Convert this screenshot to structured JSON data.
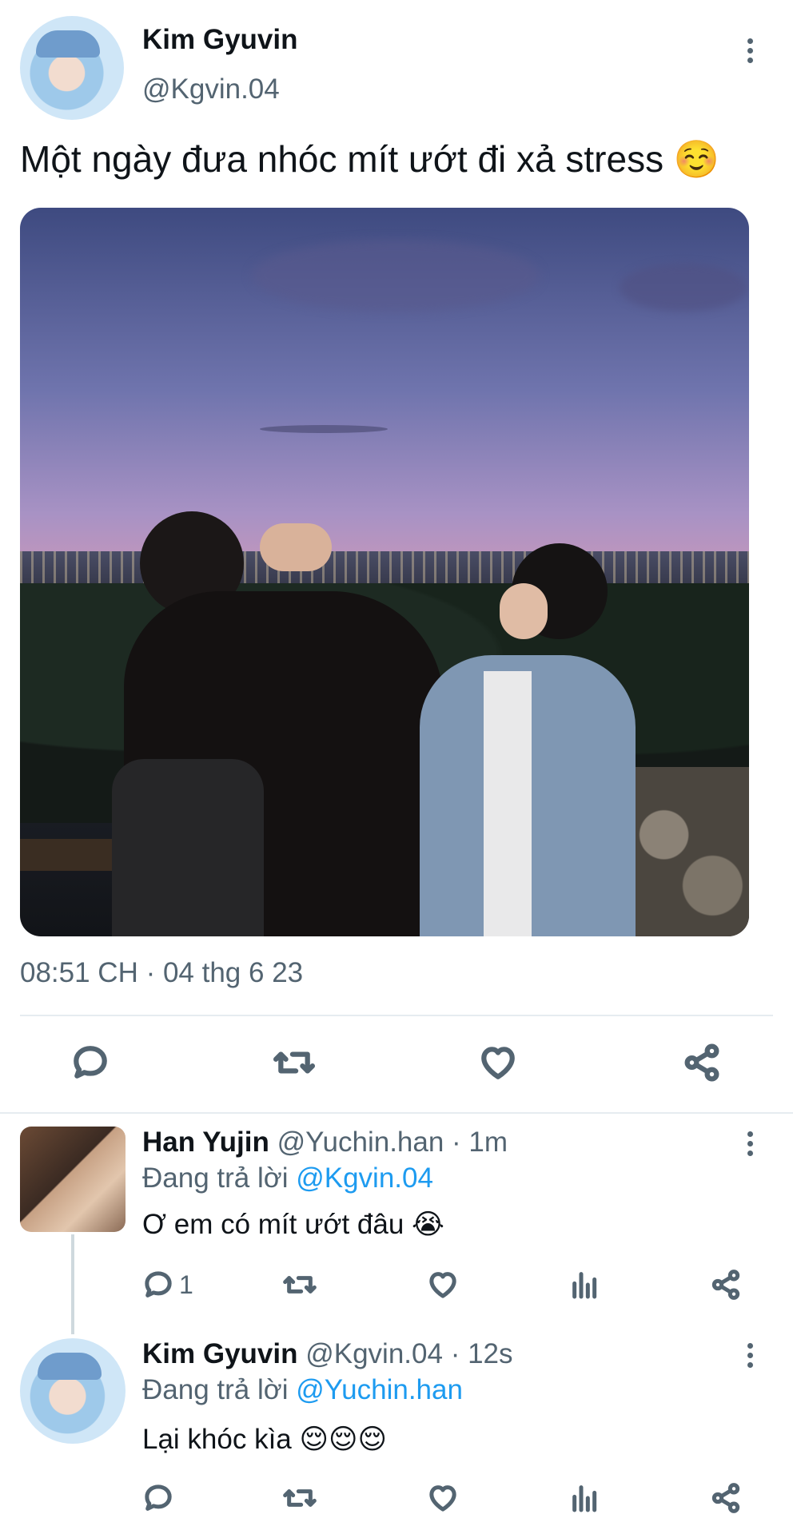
{
  "tweet": {
    "author_name": "Kim Gyuvin",
    "author_handle": "@Kgvin.04",
    "text": "Một ngày đưa nhóc mít ướt đi xả stress ☺️",
    "timestamp": "08:51 CH · 04 thg 6 23",
    "actions": [
      "reply-icon",
      "retweet-icon",
      "like-icon",
      "share-icon"
    ]
  },
  "replies": [
    {
      "name": "Han Yujin",
      "handle": "@Yuchin.han",
      "time": " · 1m",
      "replying_prefix": "Đang trả lời ",
      "replying_to": "@Kgvin.04",
      "text": "Ơ em có mít ướt đâu 😭",
      "reply_count": "1"
    },
    {
      "name": "Kim Gyuvin",
      "handle": "@Kgvin.04",
      "time": " · 12s",
      "replying_prefix": "Đang trả lời ",
      "replying_to": "@Yuchin.han",
      "text": "Lại khóc kìa 😌😌😌",
      "reply_count": ""
    }
  ],
  "colors": {
    "accent": "#1d9bf0",
    "muted": "#536471",
    "divider": "#e6ecf0"
  }
}
